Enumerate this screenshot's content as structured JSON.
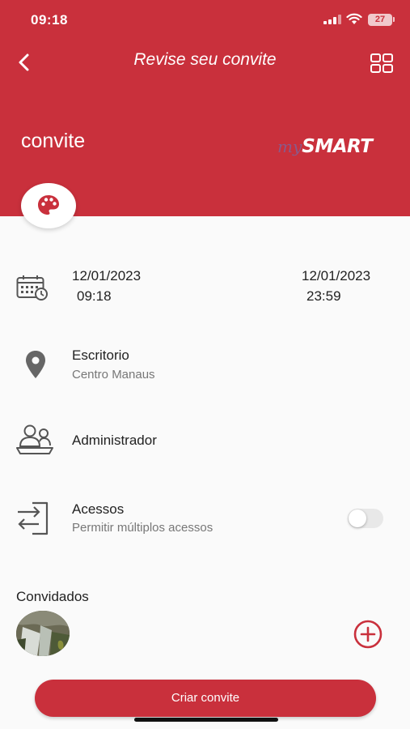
{
  "status_bar": {
    "time": "09:18",
    "battery": "27"
  },
  "nav": {
    "title": "Revise seu convite"
  },
  "header": {
    "label": "convite",
    "brand_prefix": "my",
    "brand_name": "SMART"
  },
  "schedule": {
    "start_date": "12/01/2023",
    "start_time": "09:18",
    "end_date": "12/01/2023",
    "end_time": "23:59"
  },
  "location": {
    "title": "Escritorio",
    "subtitle": "Centro Manaus"
  },
  "host": {
    "title": "Administrador"
  },
  "access": {
    "title": "Acessos",
    "subtitle": "Permitir múltiplos acessos",
    "multiple_enabled": false
  },
  "guests": {
    "title": "Convidados"
  },
  "actions": {
    "create_label": "Criar convite"
  },
  "colors": {
    "primary": "#c9303c",
    "background": "#fafafa",
    "text": "#222222",
    "muted": "#777777"
  }
}
